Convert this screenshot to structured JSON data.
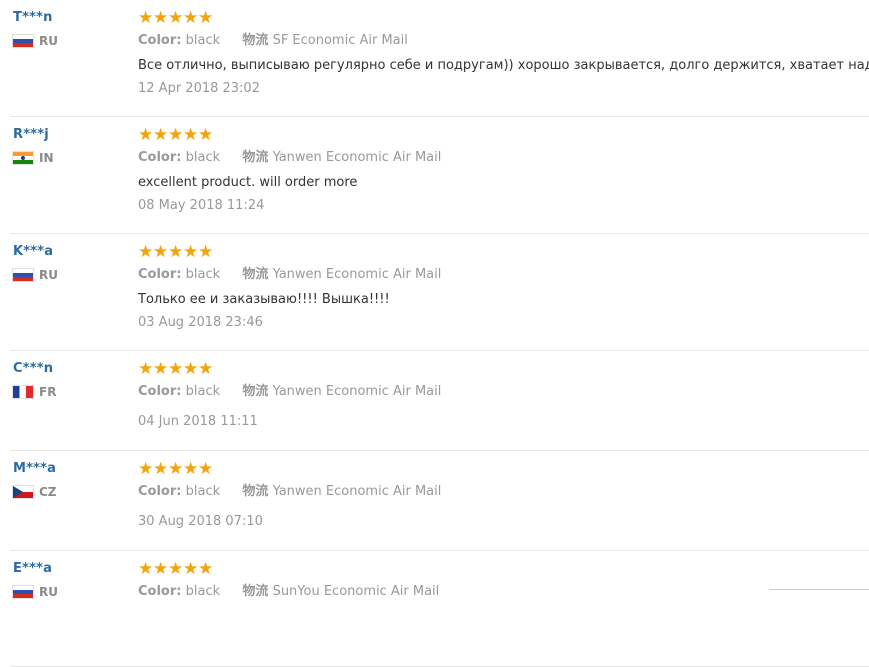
{
  "star_color": "#f5a30a",
  "reviews": [
    {
      "user": "T***n",
      "country": "RU",
      "stars": 5,
      "color_label": "Color:",
      "color_value": "black",
      "shipping_label": "物流",
      "shipping_value": "SF Economic Air Mail",
      "text": "Все отлично, выписываю регулярно себе и подругам)) хорошо закрывается, долго держится, хватает надолго",
      "date": "12 Apr 2018 23:02"
    },
    {
      "user": "R***j",
      "country": "IN",
      "stars": 5,
      "color_label": "Color:",
      "color_value": "black",
      "shipping_label": "物流",
      "shipping_value": "Yanwen Economic Air Mail",
      "text": "excellent product. will order more",
      "date": "08 May 2018 11:24"
    },
    {
      "user": "K***a",
      "country": "RU",
      "stars": 5,
      "color_label": "Color:",
      "color_value": "black",
      "shipping_label": "物流",
      "shipping_value": "Yanwen Economic Air Mail",
      "text": "Только ее и заказываю!!!! Вышка!!!!",
      "date": "03 Aug 2018 23:46"
    },
    {
      "user": "C***n",
      "country": "FR",
      "stars": 5,
      "color_label": "Color:",
      "color_value": "black",
      "shipping_label": "物流",
      "shipping_value": "Yanwen Economic Air Mail",
      "text": "",
      "date": "04 Jun 2018 11:11"
    },
    {
      "user": "M***a",
      "country": "CZ",
      "stars": 5,
      "color_label": "Color:",
      "color_value": "black",
      "shipping_label": "物流",
      "shipping_value": "Yanwen Economic Air Mail",
      "text": "",
      "date": "30 Aug 2018 07:10"
    },
    {
      "user": "E***a",
      "country": "RU",
      "stars": 5,
      "color_label": "Color:",
      "color_value": "black",
      "shipping_label": "物流",
      "shipping_value": "SunYou Economic Air Mail",
      "text": "",
      "date": ""
    }
  ]
}
